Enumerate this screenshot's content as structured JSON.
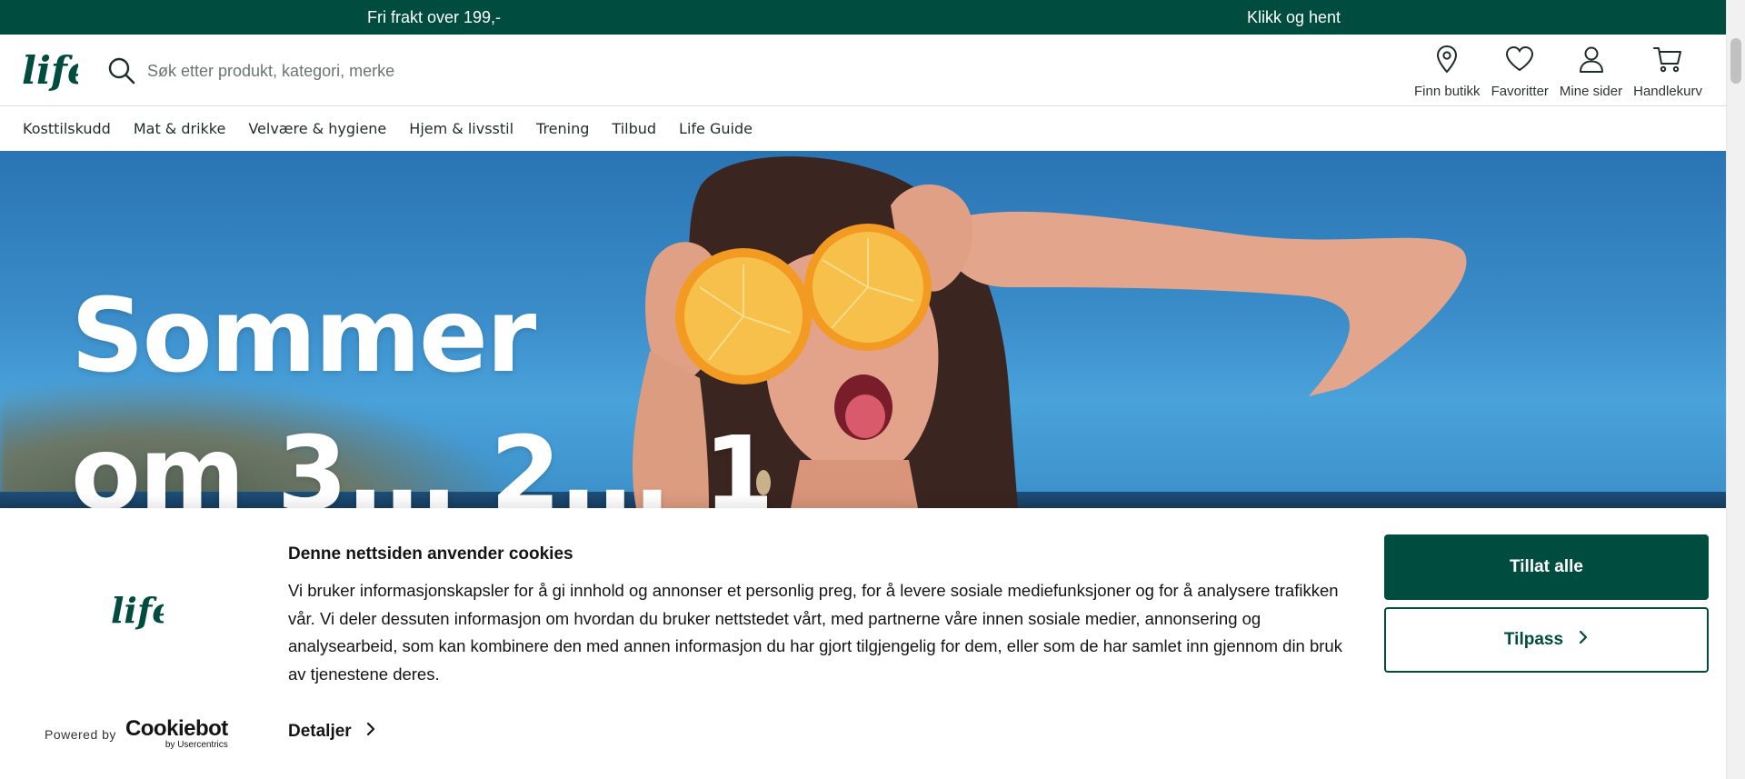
{
  "promo_bar": {
    "left_text": "Fri frakt over 199,-",
    "right_text": "Klikk og hent"
  },
  "header": {
    "logo_text": "life",
    "search": {
      "placeholder": "Søk etter produkt, kategori, merke",
      "value": ""
    },
    "actions": [
      {
        "label": "Finn butikk",
        "icon": "map-pin-icon"
      },
      {
        "label": "Favoritter",
        "icon": "heart-icon"
      },
      {
        "label": "Mine sider",
        "icon": "user-icon"
      },
      {
        "label": "Handlekurv",
        "icon": "cart-icon"
      }
    ]
  },
  "nav": {
    "items": [
      "Kosttilskudd",
      "Mat & drikke",
      "Velvære & hygiene",
      "Hjem & livsstil",
      "Trening",
      "Tilbud",
      "Life Guide"
    ]
  },
  "hero": {
    "headline_line1": "Sommer",
    "headline_line2": "om 3... 2... 1"
  },
  "cookie_banner": {
    "title": "Denne nettsiden anvender cookies",
    "body": "Vi bruker informasjonskapsler for å gi innhold og annonser et personlig preg, for å levere sosiale mediefunksjoner og for å analysere trafikken vår. Vi deler dessuten informasjon om hvordan du bruker nettstedet vårt, med partnerne våre innen sosiale medier, annonsering og analysearbeid, som kan kombinere den med annen informasjon du har gjort tilgjengelig for dem, eller som de har samlet inn gjennom din bruk av tjenestene deres.",
    "details_label": "Detaljer",
    "allow_all_label": "Tillat alle",
    "customize_label": "Tilpass",
    "powered_by_label": "Powered by",
    "cookiebot_name": "Cookiebot",
    "cookiebot_sub": "by Usercentrics"
  },
  "colors": {
    "brand_green": "#004c3f",
    "sky_blue": "#3a8cc9",
    "text_dark": "#141414"
  }
}
